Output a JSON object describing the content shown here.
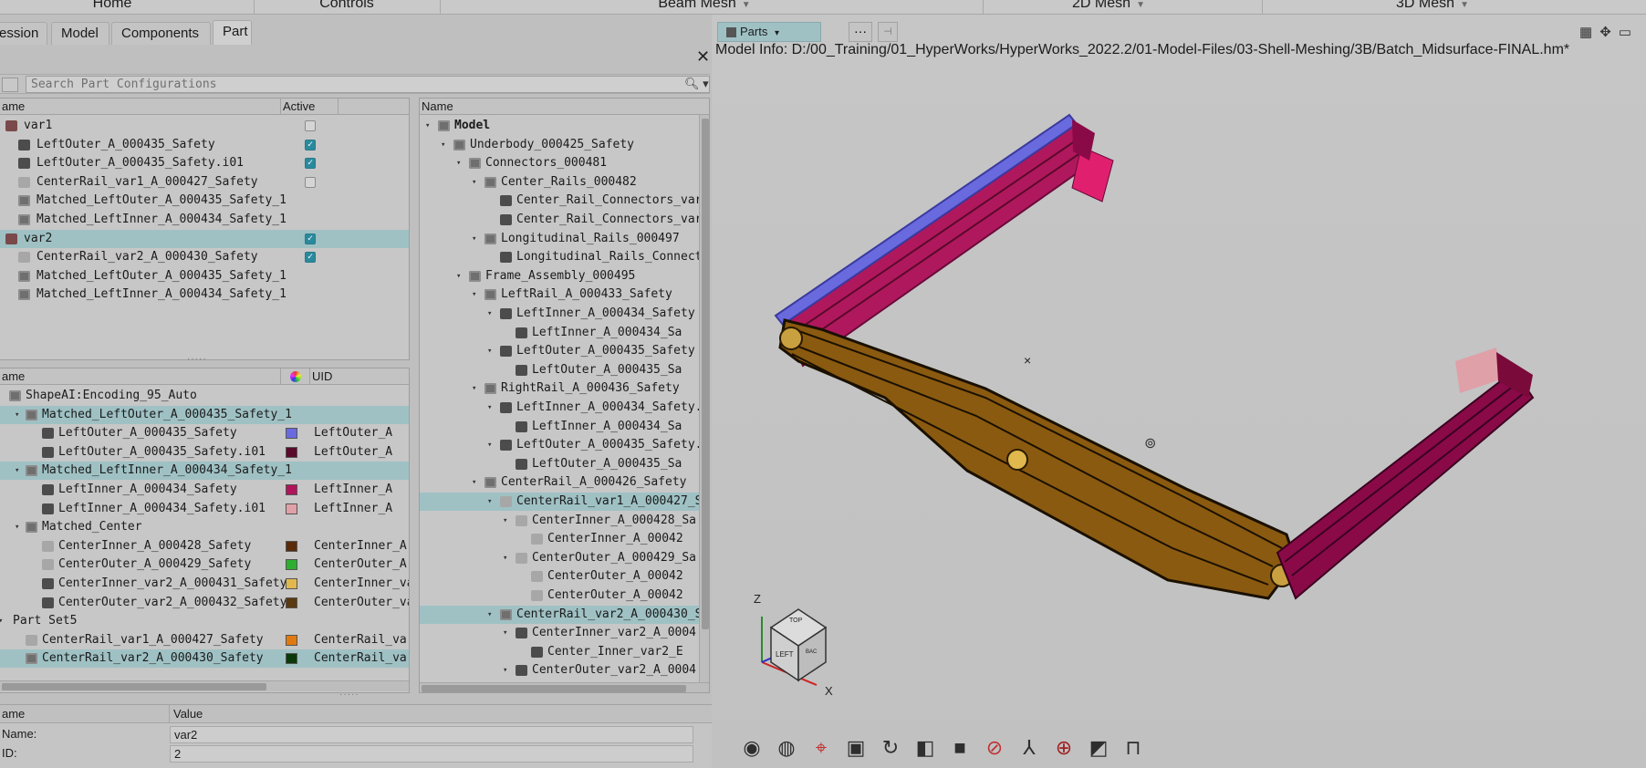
{
  "ribbon": {
    "tabs": [
      {
        "label": "Home",
        "arrow": ""
      },
      {
        "label": "Controls",
        "arrow": ""
      },
      {
        "label": "Beam Mesh",
        "arrow": "▼"
      },
      {
        "label": "2D Mesh",
        "arrow": "▼"
      },
      {
        "label": "3D Mesh",
        "arrow": "▼"
      }
    ]
  },
  "browser_tabs": [
    "ession",
    "Model",
    "Components",
    "Part"
  ],
  "active_browser_tab": "Part",
  "search": {
    "placeholder": "Search Part Configurations"
  },
  "config_panel": {
    "col_name": "ame",
    "col_active": "Active",
    "rows": [
      {
        "label": "var1",
        "indent": 0,
        "icon": "varic",
        "check": "off",
        "selected": false
      },
      {
        "label": "LeftOuter_A_000435_Safety",
        "indent": 1,
        "icon": "part",
        "check": "on",
        "selected": false
      },
      {
        "label": "LeftOuter_A_000435_Safety.i01",
        "indent": 1,
        "icon": "part",
        "check": "on",
        "selected": false
      },
      {
        "label": "CenterRail_var1_A_000427_Safety",
        "indent": 1,
        "icon": "partlite",
        "check": "off",
        "selected": false
      },
      {
        "label": "Matched_LeftOuter_A_000435_Safety_1",
        "indent": 1,
        "icon": "assy",
        "check": "",
        "selected": false
      },
      {
        "label": "Matched_LeftInner_A_000434_Safety_1",
        "indent": 1,
        "icon": "assy",
        "check": "",
        "selected": false
      },
      {
        "label": "var2",
        "indent": 0,
        "icon": "varic",
        "check": "on",
        "selected": true
      },
      {
        "label": "CenterRail_var2_A_000430_Safety",
        "indent": 1,
        "icon": "partlite",
        "check": "on",
        "selected": false
      },
      {
        "label": "Matched_LeftOuter_A_000435_Safety_1",
        "indent": 1,
        "icon": "assy",
        "check": "",
        "selected": false
      },
      {
        "label": "Matched_LeftInner_A_000434_Safety_1",
        "indent": 1,
        "icon": "assy",
        "check": "",
        "selected": false
      }
    ]
  },
  "shape_panel": {
    "col_name": "ame",
    "col_uid": "UID",
    "rows": [
      {
        "label": "ShapeAI:Encoding_95_Auto",
        "indent": 0,
        "icon": "assy",
        "tw": "",
        "color": "",
        "uid": "",
        "selected": false
      },
      {
        "label": "Matched_LeftOuter_A_000435_Safety_1",
        "indent": 1,
        "icon": "assy",
        "tw": "▾",
        "color": "",
        "uid": "",
        "selected": true
      },
      {
        "label": "LeftOuter_A_000435_Safety",
        "indent": 2,
        "icon": "part",
        "tw": "",
        "color": "#6a6adf",
        "uid": "LeftOuter_A",
        "selected": false
      },
      {
        "label": "LeftOuter_A_000435_Safety.i01",
        "indent": 2,
        "icon": "part",
        "tw": "",
        "color": "#5a0a2a",
        "uid": "LeftOuter_A",
        "selected": false
      },
      {
        "label": "Matched_LeftInner_A_000434_Safety_1",
        "indent": 1,
        "icon": "assy",
        "tw": "▾",
        "color": "",
        "uid": "",
        "selected": true
      },
      {
        "label": "LeftInner_A_000434_Safety",
        "indent": 2,
        "icon": "part",
        "tw": "",
        "color": "#b0145a",
        "uid": "LeftInner_A",
        "selected": false
      },
      {
        "label": "LeftInner_A_000434_Safety.i01",
        "indent": 2,
        "icon": "part",
        "tw": "",
        "color": "#e0a0a8",
        "uid": "LeftInner_A",
        "selected": false
      },
      {
        "label": "Matched_Center",
        "indent": 1,
        "icon": "assy",
        "tw": "▾",
        "color": "",
        "uid": "",
        "selected": false
      },
      {
        "label": "CenterInner_A_000428_Safety",
        "indent": 2,
        "icon": "partlite",
        "tw": "",
        "color": "#5a2a0a",
        "uid": "CenterInner_A",
        "selected": false
      },
      {
        "label": "CenterOuter_A_000429_Safety",
        "indent": 2,
        "icon": "partlite",
        "tw": "",
        "color": "#2eae2e",
        "uid": "CenterOuter_A",
        "selected": false
      },
      {
        "label": "CenterInner_var2_A_000431_Safety",
        "indent": 2,
        "icon": "part",
        "tw": "",
        "color": "#e0b84e",
        "uid": "CenterInner_va",
        "selected": false
      },
      {
        "label": "CenterOuter_var2_A_000432_Safety",
        "indent": 2,
        "icon": "part",
        "tw": "",
        "color": "#5a3a10",
        "uid": "CenterOuter_va",
        "selected": false
      },
      {
        "label": "Part Set5",
        "indent": 0,
        "icon": "",
        "tw": "▾",
        "color": "",
        "uid": "",
        "selected": false
      },
      {
        "label": "CenterRail_var1_A_000427_Safety",
        "indent": 1,
        "icon": "partlite",
        "tw": "",
        "color": "#e07a10",
        "uid": "CenterRail_var",
        "selected": false
      },
      {
        "label": "CenterRail_var2_A_000430_Safety",
        "indent": 1,
        "icon": "assy",
        "tw": "",
        "color": "#0a3a0a",
        "uid": "CenterRail_var",
        "selected": true
      }
    ]
  },
  "model_tree": {
    "col_name": "Name",
    "rows": [
      {
        "label": "Model",
        "indent": 0,
        "tw": "▾",
        "icon": "assy",
        "bold": true,
        "selected": false
      },
      {
        "label": "Underbody_000425_Safety",
        "indent": 1,
        "tw": "▾",
        "icon": "assy",
        "bold": false,
        "selected": false
      },
      {
        "label": "Connectors_000481",
        "indent": 2,
        "tw": "▾",
        "icon": "assy",
        "bold": false,
        "selected": false
      },
      {
        "label": "Center_Rails_000482",
        "indent": 3,
        "tw": "▾",
        "icon": "assy",
        "bold": false,
        "selected": false
      },
      {
        "label": "Center_Rail_Connectors_var",
        "indent": 4,
        "tw": "",
        "icon": "part",
        "bold": false,
        "selected": false
      },
      {
        "label": "Center_Rail_Connectors_var",
        "indent": 4,
        "tw": "",
        "icon": "part",
        "bold": false,
        "selected": false
      },
      {
        "label": "Longitudinal_Rails_000497",
        "indent": 3,
        "tw": "▾",
        "icon": "assy",
        "bold": false,
        "selected": false
      },
      {
        "label": "Longitudinal_Rails_Connect",
        "indent": 4,
        "tw": "",
        "icon": "part",
        "bold": false,
        "selected": false
      },
      {
        "label": "Frame_Assembly_000495",
        "indent": 2,
        "tw": "▾",
        "icon": "assy",
        "bold": false,
        "selected": false
      },
      {
        "label": "LeftRail_A_000433_Safety",
        "indent": 3,
        "tw": "▾",
        "icon": "assy",
        "bold": false,
        "selected": false
      },
      {
        "label": "LeftInner_A_000434_Safety",
        "indent": 4,
        "tw": "▾",
        "icon": "part",
        "bold": false,
        "selected": false
      },
      {
        "label": "LeftInner_A_000434_Sa",
        "indent": 5,
        "tw": "",
        "icon": "part",
        "bold": false,
        "selected": false
      },
      {
        "label": "LeftOuter_A_000435_Safety",
        "indent": 4,
        "tw": "▾",
        "icon": "part",
        "bold": false,
        "selected": false
      },
      {
        "label": "LeftOuter_A_000435_Sa",
        "indent": 5,
        "tw": "",
        "icon": "part",
        "bold": false,
        "selected": false
      },
      {
        "label": "RightRail_A_000436_Safety",
        "indent": 3,
        "tw": "▾",
        "icon": "assy",
        "bold": false,
        "selected": false
      },
      {
        "label": "LeftInner_A_000434_Safety.",
        "indent": 4,
        "tw": "▾",
        "icon": "part",
        "bold": false,
        "selected": false
      },
      {
        "label": "LeftInner_A_000434_Sa",
        "indent": 5,
        "tw": "",
        "icon": "part",
        "bold": false,
        "selected": false
      },
      {
        "label": "LeftOuter_A_000435_Safety.",
        "indent": 4,
        "tw": "▾",
        "icon": "part",
        "bold": false,
        "selected": false
      },
      {
        "label": "LeftOuter_A_000435_Sa",
        "indent": 5,
        "tw": "",
        "icon": "part",
        "bold": false,
        "selected": false
      },
      {
        "label": "CenterRail_A_000426_Safety",
        "indent": 3,
        "tw": "▾",
        "icon": "assy",
        "bold": false,
        "selected": false
      },
      {
        "label": "CenterRail_var1_A_000427_S",
        "indent": 4,
        "tw": "▾",
        "icon": "partlite",
        "bold": false,
        "selected": true
      },
      {
        "label": "CenterInner_A_000428_Sa",
        "indent": 5,
        "tw": "▾",
        "icon": "partlite",
        "bold": false,
        "selected": false
      },
      {
        "label": "CenterInner_A_00042",
        "indent": 6,
        "tw": "",
        "icon": "partlite",
        "bold": false,
        "selected": false
      },
      {
        "label": "CenterOuter_A_000429_Sa",
        "indent": 5,
        "tw": "▾",
        "icon": "partlite",
        "bold": false,
        "selected": false
      },
      {
        "label": "CenterOuter_A_00042",
        "indent": 6,
        "tw": "",
        "icon": "partlite",
        "bold": false,
        "selected": false
      },
      {
        "label": "CenterOuter_A_00042",
        "indent": 6,
        "tw": "",
        "icon": "partlite",
        "bold": false,
        "selected": false
      },
      {
        "label": "CenterRail_var2_A_000430_S",
        "indent": 4,
        "tw": "▾",
        "icon": "assy",
        "bold": false,
        "selected": true
      },
      {
        "label": "CenterInner_var2_A_0004",
        "indent": 5,
        "tw": "▾",
        "icon": "part",
        "bold": false,
        "selected": false
      },
      {
        "label": "Center_Inner_var2_E",
        "indent": 6,
        "tw": "",
        "icon": "part",
        "bold": false,
        "selected": false
      },
      {
        "label": "CenterOuter_var2_A_0004",
        "indent": 5,
        "tw": "▾",
        "icon": "part",
        "bold": false,
        "selected": false
      }
    ]
  },
  "properties": {
    "col_name": "ame",
    "col_value": "Value",
    "rows": [
      {
        "name": "Name:",
        "value": "var2"
      },
      {
        "name": "ID:",
        "value": "2"
      }
    ]
  },
  "viewport": {
    "parts_button": "Parts",
    "parts_arrow": "▾",
    "more_button": "···",
    "pin_button": "⊣",
    "model_info": "Model Info: D:/00_Training/01_HyperWorks/HyperWorks_2022.2/01-Model-Files/03-Shell-Meshing/3B/Batch_Midsurface-FINAL.hm*",
    "axis_z": "Z",
    "axis_x": "X",
    "cube_top": "TOP",
    "cube_left": "LEFT",
    "cube_back": "BAC"
  }
}
